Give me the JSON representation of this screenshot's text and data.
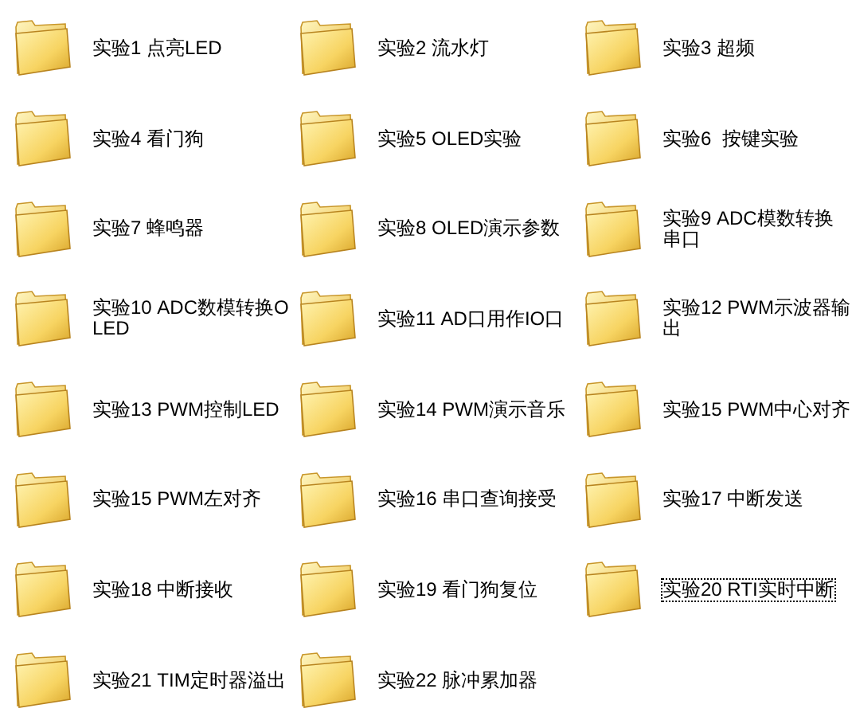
{
  "items": [
    {
      "label": "实验1 点亮LED",
      "focused": false
    },
    {
      "label": "实验2 流水灯",
      "focused": false
    },
    {
      "label": "实验3 超频",
      "focused": false
    },
    {
      "label": "实验4 看门狗",
      "focused": false
    },
    {
      "label": "实验5 OLED实验",
      "focused": false
    },
    {
      "label": "实验6  按键实验",
      "focused": false
    },
    {
      "label": "实验7 蜂鸣器",
      "focused": false
    },
    {
      "label": "实验8 OLED演示参数",
      "focused": false
    },
    {
      "label": "实验9 ADC模数转换串口",
      "focused": false
    },
    {
      "label": "实验10 ADC数模转换OLED",
      "focused": false
    },
    {
      "label": "实验11 AD口用作IO口",
      "focused": false
    },
    {
      "label": "实验12 PWM示波器输出",
      "focused": false
    },
    {
      "label": "实验13 PWM控制LED",
      "focused": false
    },
    {
      "label": "实验14 PWM演示音乐",
      "focused": false
    },
    {
      "label": "实验15 PWM中心对齐",
      "focused": false
    },
    {
      "label": "实验15 PWM左对齐",
      "focused": false
    },
    {
      "label": "实验16 串口查询接受",
      "focused": false
    },
    {
      "label": "实验17 中断发送",
      "focused": false
    },
    {
      "label": "实验18 中断接收",
      "focused": false
    },
    {
      "label": "实验19 看门狗复位",
      "focused": false
    },
    {
      "label": "实验20 RTI实时中断",
      "focused": true
    },
    {
      "label": "实验21 TIM定时器溢出",
      "focused": false
    },
    {
      "label": "实验22 脉冲累加器",
      "focused": false
    }
  ]
}
